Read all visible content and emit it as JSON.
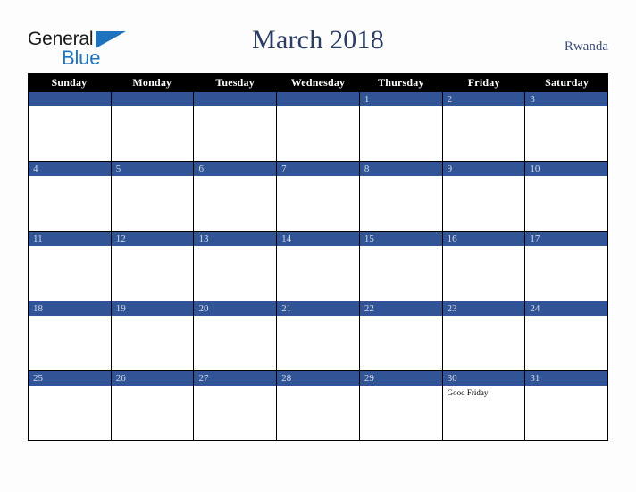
{
  "header": {
    "logo": {
      "text_primary": "General",
      "text_secondary": "Blue",
      "icon": "triangle-icon",
      "color_primary": "#1b1b1b",
      "color_secondary": "#1f72bd"
    },
    "title": "March 2018",
    "country": "Rwanda",
    "title_color": "#2b3d62"
  },
  "calendar": {
    "month": "March",
    "year": "2018",
    "header_background": "#000000",
    "date_bar_color": "#305495",
    "weekdays": [
      "Sunday",
      "Monday",
      "Tuesday",
      "Wednesday",
      "Thursday",
      "Friday",
      "Saturday"
    ],
    "weeks": [
      [
        {
          "day": "",
          "blank": true,
          "events": []
        },
        {
          "day": "",
          "blank": true,
          "events": []
        },
        {
          "day": "",
          "blank": true,
          "events": []
        },
        {
          "day": "",
          "blank": true,
          "events": []
        },
        {
          "day": "1",
          "blank": false,
          "events": []
        },
        {
          "day": "2",
          "blank": false,
          "events": []
        },
        {
          "day": "3",
          "blank": false,
          "events": []
        }
      ],
      [
        {
          "day": "4",
          "blank": false,
          "events": []
        },
        {
          "day": "5",
          "blank": false,
          "events": []
        },
        {
          "day": "6",
          "blank": false,
          "events": []
        },
        {
          "day": "7",
          "blank": false,
          "events": []
        },
        {
          "day": "8",
          "blank": false,
          "events": []
        },
        {
          "day": "9",
          "blank": false,
          "events": []
        },
        {
          "day": "10",
          "blank": false,
          "events": []
        }
      ],
      [
        {
          "day": "11",
          "blank": false,
          "events": []
        },
        {
          "day": "12",
          "blank": false,
          "events": []
        },
        {
          "day": "13",
          "blank": false,
          "events": []
        },
        {
          "day": "14",
          "blank": false,
          "events": []
        },
        {
          "day": "15",
          "blank": false,
          "events": []
        },
        {
          "day": "16",
          "blank": false,
          "events": []
        },
        {
          "day": "17",
          "blank": false,
          "events": []
        }
      ],
      [
        {
          "day": "18",
          "blank": false,
          "events": []
        },
        {
          "day": "19",
          "blank": false,
          "events": []
        },
        {
          "day": "20",
          "blank": false,
          "events": []
        },
        {
          "day": "21",
          "blank": false,
          "events": []
        },
        {
          "day": "22",
          "blank": false,
          "events": []
        },
        {
          "day": "23",
          "blank": false,
          "events": []
        },
        {
          "day": "24",
          "blank": false,
          "events": []
        }
      ],
      [
        {
          "day": "25",
          "blank": false,
          "events": []
        },
        {
          "day": "26",
          "blank": false,
          "events": []
        },
        {
          "day": "27",
          "blank": false,
          "events": []
        },
        {
          "day": "28",
          "blank": false,
          "events": []
        },
        {
          "day": "29",
          "blank": false,
          "events": []
        },
        {
          "day": "30",
          "blank": false,
          "events": [
            "Good Friday"
          ]
        },
        {
          "day": "31",
          "blank": false,
          "events": []
        }
      ]
    ]
  }
}
